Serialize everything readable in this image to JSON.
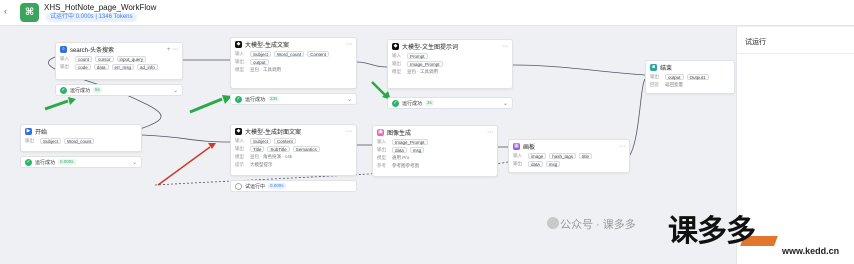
{
  "header": {
    "title": "XHS_HotNote_page_WorkFlow",
    "status": "试运行中 0.000s | 1346 Tokens"
  },
  "right_panel": {
    "title": "试运行"
  },
  "nodes": {
    "search": {
      "title": "search-头条搜索",
      "in_label": "输入",
      "in1": "count",
      "in2": "cursor",
      "in3": "input_query",
      "out_label": "输出",
      "out1": "code",
      "out2": "data",
      "out3": "err_msg",
      "out4": "ad_info"
    },
    "start": {
      "title": "开始",
      "out_label": "输出",
      "out1": "Subject",
      "out2": "Word_count"
    },
    "gen_text": {
      "title": "大模型-生成文案",
      "in_label": "输入",
      "in1": "Subject",
      "in2": "Word_count",
      "in3": "Content",
      "out_label": "输出",
      "out1": "output",
      "model_label": "模型",
      "model": "豆包 · 工具调用"
    },
    "gen_cover": {
      "title": "大模型-生成封面文案",
      "in_label": "输入",
      "in1": "Subject",
      "in2": "Content",
      "out_label": "输出",
      "out1": "Title",
      "out2": "SubTitle",
      "out3": "Semantics",
      "model_label": "模型",
      "model": "豆包 · 角色扮演 · c4k",
      "prompt_label": "提示",
      "prompt": "大模型提示"
    },
    "gen_image_prompt": {
      "title": "大模型-文生图提示词",
      "in_label": "输入",
      "in1": "Prompt",
      "out_label": "输出",
      "out1": "Image_Prompt",
      "model_label": "模型",
      "model": "豆包 · 工具调用"
    },
    "image_gen": {
      "title": "图像生成",
      "in_label": "输入",
      "in1": "Image_Prompt",
      "out_label": "输出",
      "out1": "data",
      "out2": "msg",
      "model_label": "模型",
      "model": "通用 Pro",
      "extra_label": "参考",
      "extra": "参考图参考图"
    },
    "canvas": {
      "title": "画板",
      "in_label": "输入",
      "in1": "image",
      "in2": "hash_tags",
      "in3": "title",
      "out_label": "输出",
      "out1": "data",
      "out2": "msg"
    },
    "end": {
      "title": "结束",
      "out_label": "输出",
      "out1": "output",
      "out2": "Output1",
      "ret_label": "回答",
      "ret": "返回变量"
    }
  },
  "results": {
    "search": {
      "label": "运行成功",
      "time": "5s"
    },
    "start": {
      "label": "运行成功",
      "time": "0.000s"
    },
    "gen_text": {
      "label": "运行成功",
      "time": "23s"
    },
    "gen_image_prompt": {
      "label": "运行成功",
      "time": "3s"
    },
    "gen_cover": {
      "label": "试运行中",
      "time": "0.000s"
    }
  },
  "watermark": {
    "text": "公众号 · 课多多",
    "logo": "课多多",
    "url": "www.kedd.cn"
  },
  "colors": {
    "success": "#2fb36b",
    "accent": "#3b82f6",
    "arrow": "#2aa84a",
    "arrow_red": "#d23a2a"
  }
}
